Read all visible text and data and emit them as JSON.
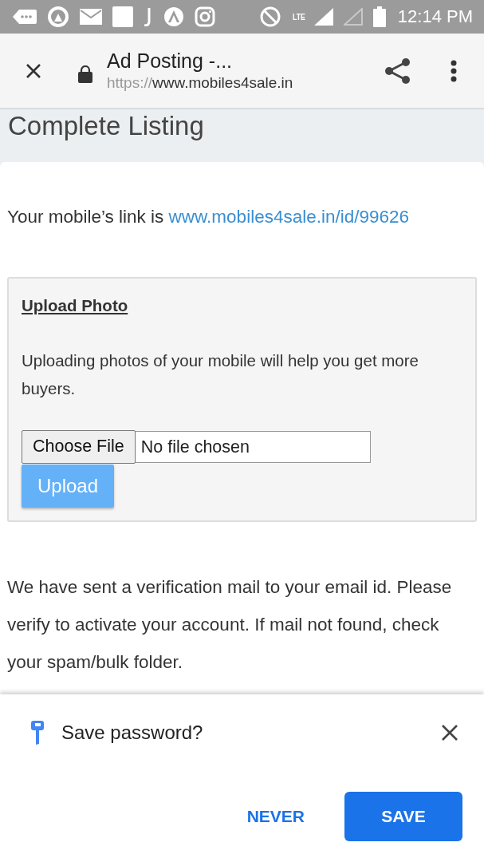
{
  "status_bar": {
    "network": "LTE",
    "time": "12:14 PM"
  },
  "toolbar": {
    "title": "Ad Posting -...",
    "url_scheme": "https://",
    "url_host": "www.mobiles4sale.in"
  },
  "page": {
    "heading": "Complete Listing",
    "link_intro": "Your mobile’s link is ",
    "link": "www.mobiles4sale.in/id/99626",
    "upload": {
      "title": "Upload Photo",
      "description": "Uploading photos of your mobile will help you get more buyers.",
      "choose_button": "Choose File",
      "file_status": "No file chosen",
      "upload_button": "Upload"
    },
    "verification": "We have sent a verification mail to your email id. Please verify to activate your account. If mail not found, check your spam/bulk folder."
  },
  "password_prompt": {
    "title": "Save password?",
    "buttons": [
      {
        "label": "NEVER",
        "kind": "text"
      },
      {
        "label": "SAVE",
        "kind": "filled"
      }
    ]
  }
}
